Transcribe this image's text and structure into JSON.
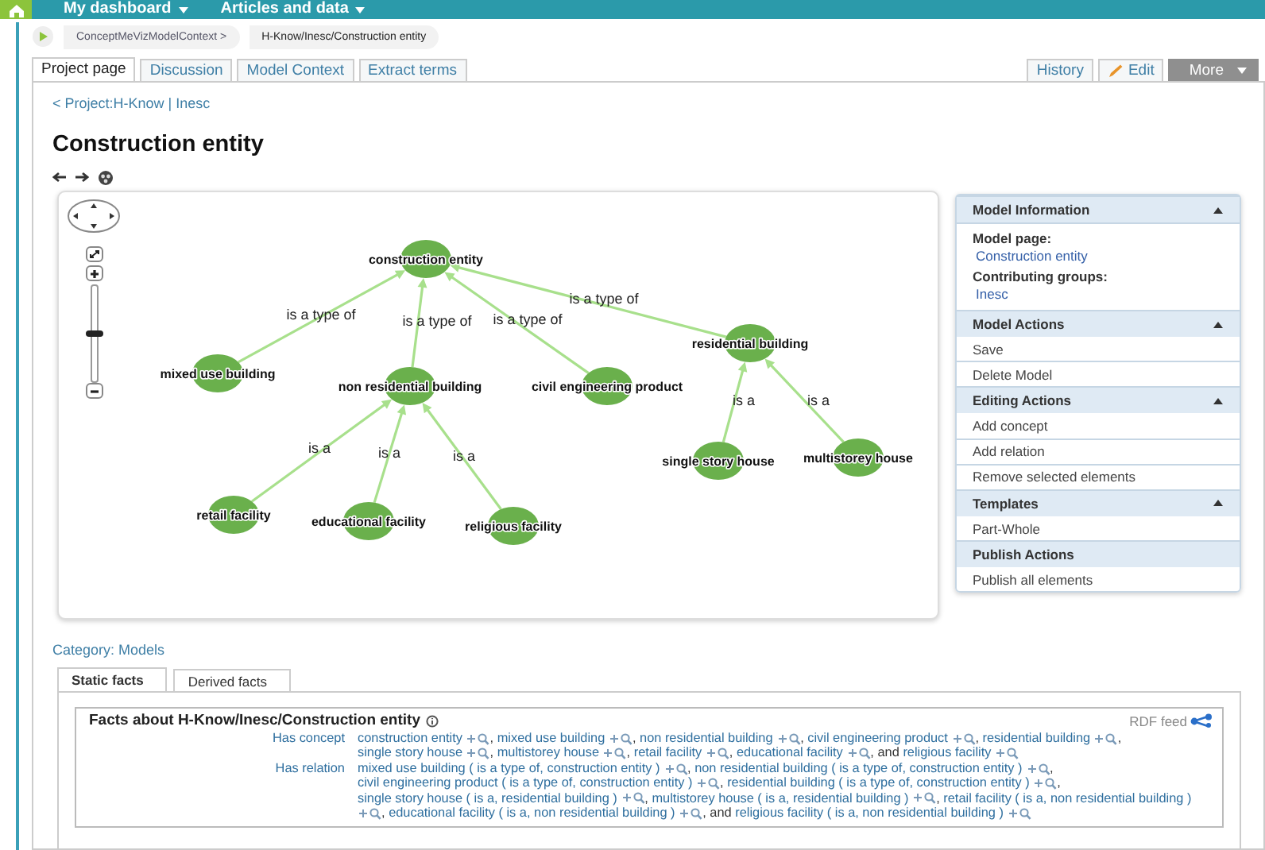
{
  "top_nav": [
    {
      "label": "My dashboard"
    },
    {
      "label": "Articles and data"
    }
  ],
  "breadcrumb": [
    "ConceptMeVizModelContext >",
    "H-Know/Inesc/Construction entity"
  ],
  "tabs": [
    {
      "label": "Project page",
      "selected": true
    },
    {
      "label": "Discussion",
      "selected": false
    },
    {
      "label": "Model Context",
      "selected": false
    },
    {
      "label": "Extract terms",
      "selected": false
    }
  ],
  "actions": [
    {
      "label": "History",
      "kind": "tab"
    },
    {
      "label": "Edit",
      "kind": "edit"
    },
    {
      "label": "More",
      "kind": "menu"
    }
  ],
  "back_link": "< Project:H-Know | Inesc",
  "title": "Construction entity",
  "graph": {
    "zoom": {
      "level": 0.5
    },
    "root": {
      "label": "construction entity",
      "children": [
        {
          "label": "mixed use building",
          "relation": "is a type of"
        },
        {
          "label": "non residential building",
          "relation": "is a type of",
          "children": [
            {
              "label": "retail facility",
              "relation": "is a"
            },
            {
              "label": "educational facility",
              "relation": "is a"
            },
            {
              "label": "religious facility",
              "relation": "is a"
            }
          ]
        },
        {
          "label": "civil engineering product",
          "relation": "is a type of"
        },
        {
          "label": "residential building",
          "relation": "is a type of",
          "children": [
            {
              "label": "single story house",
              "relation": "is a"
            },
            {
              "label": "multistorey house",
              "relation": "is a"
            }
          ]
        }
      ]
    }
  },
  "side_panel": [
    {
      "title": "Model Information",
      "collapsible": true,
      "items": [
        {
          "kind": "label",
          "text": "Model page:"
        },
        {
          "kind": "link",
          "text": "Construction entity"
        },
        {
          "kind": "label",
          "text": "Contributing groups:"
        },
        {
          "kind": "link",
          "text": "Inesc"
        }
      ]
    },
    {
      "title": "Model Actions",
      "collapsible": true,
      "items": [
        {
          "kind": "action",
          "text": "Save"
        },
        {
          "kind": "action",
          "text": "Delete Model"
        }
      ]
    },
    {
      "title": "Editing Actions",
      "collapsible": true,
      "items": [
        {
          "kind": "action",
          "text": "Add concept"
        },
        {
          "kind": "action",
          "text": "Add relation"
        },
        {
          "kind": "action",
          "text": "Remove selected elements"
        }
      ]
    },
    {
      "title": "Templates",
      "collapsible": true,
      "items": [
        {
          "kind": "action",
          "text": "Part-Whole"
        }
      ]
    },
    {
      "title": "Publish Actions",
      "collapsible": false,
      "items": [
        {
          "kind": "action",
          "text": "Publish all elements"
        }
      ]
    }
  ],
  "category": "Category: Models",
  "fact_tabs": [
    {
      "label": "Static facts",
      "selected": true
    },
    {
      "label": "Derived facts",
      "selected": false
    }
  ],
  "facts": {
    "title": "Facts about H-Know/Inesc/Construction entity",
    "rdf_feed": "RDF feed",
    "rows": [
      {
        "label": "Has concept",
        "items": [
          {
            "text": "construction entity",
            "suffix": ","
          },
          {
            "text": "mixed use building",
            "suffix": ","
          },
          {
            "text": "non residential building",
            "suffix": ","
          },
          {
            "text": "civil engineering product",
            "suffix": ","
          },
          {
            "text": "residential building",
            "suffix": ","
          },
          {
            "text": "single story house",
            "suffix": ","
          },
          {
            "text": "multistorey house",
            "suffix": ","
          },
          {
            "text": "retail facility",
            "suffix": ","
          },
          {
            "text": "educational facility",
            "suffix": ","
          },
          {
            "text": "religious facility",
            "prefix": "and"
          }
        ]
      },
      {
        "label": "Has relation",
        "items": [
          {
            "text": "mixed use building ( is a type of, construction entity )",
            "suffix": ","
          },
          {
            "text": "non residential building ( is a type of, construction entity )",
            "suffix": ","
          },
          {
            "text": "civil engineering product ( is a type of, construction entity )",
            "suffix": ","
          },
          {
            "text": "residential building ( is a type of, construction entity )",
            "suffix": ","
          },
          {
            "text": "single story house ( is a, residential building )",
            "suffix": ","
          },
          {
            "text": "multistorey house ( is a, residential building )",
            "suffix": ","
          },
          {
            "text": "retail facility ( is a, non residential building )",
            "suffix": ","
          },
          {
            "text": "educational facility ( is a, non residential building )",
            "suffix": ","
          },
          {
            "text": "religious facility ( is a, non residential building )",
            "prefix": "and"
          }
        ]
      }
    ]
  }
}
